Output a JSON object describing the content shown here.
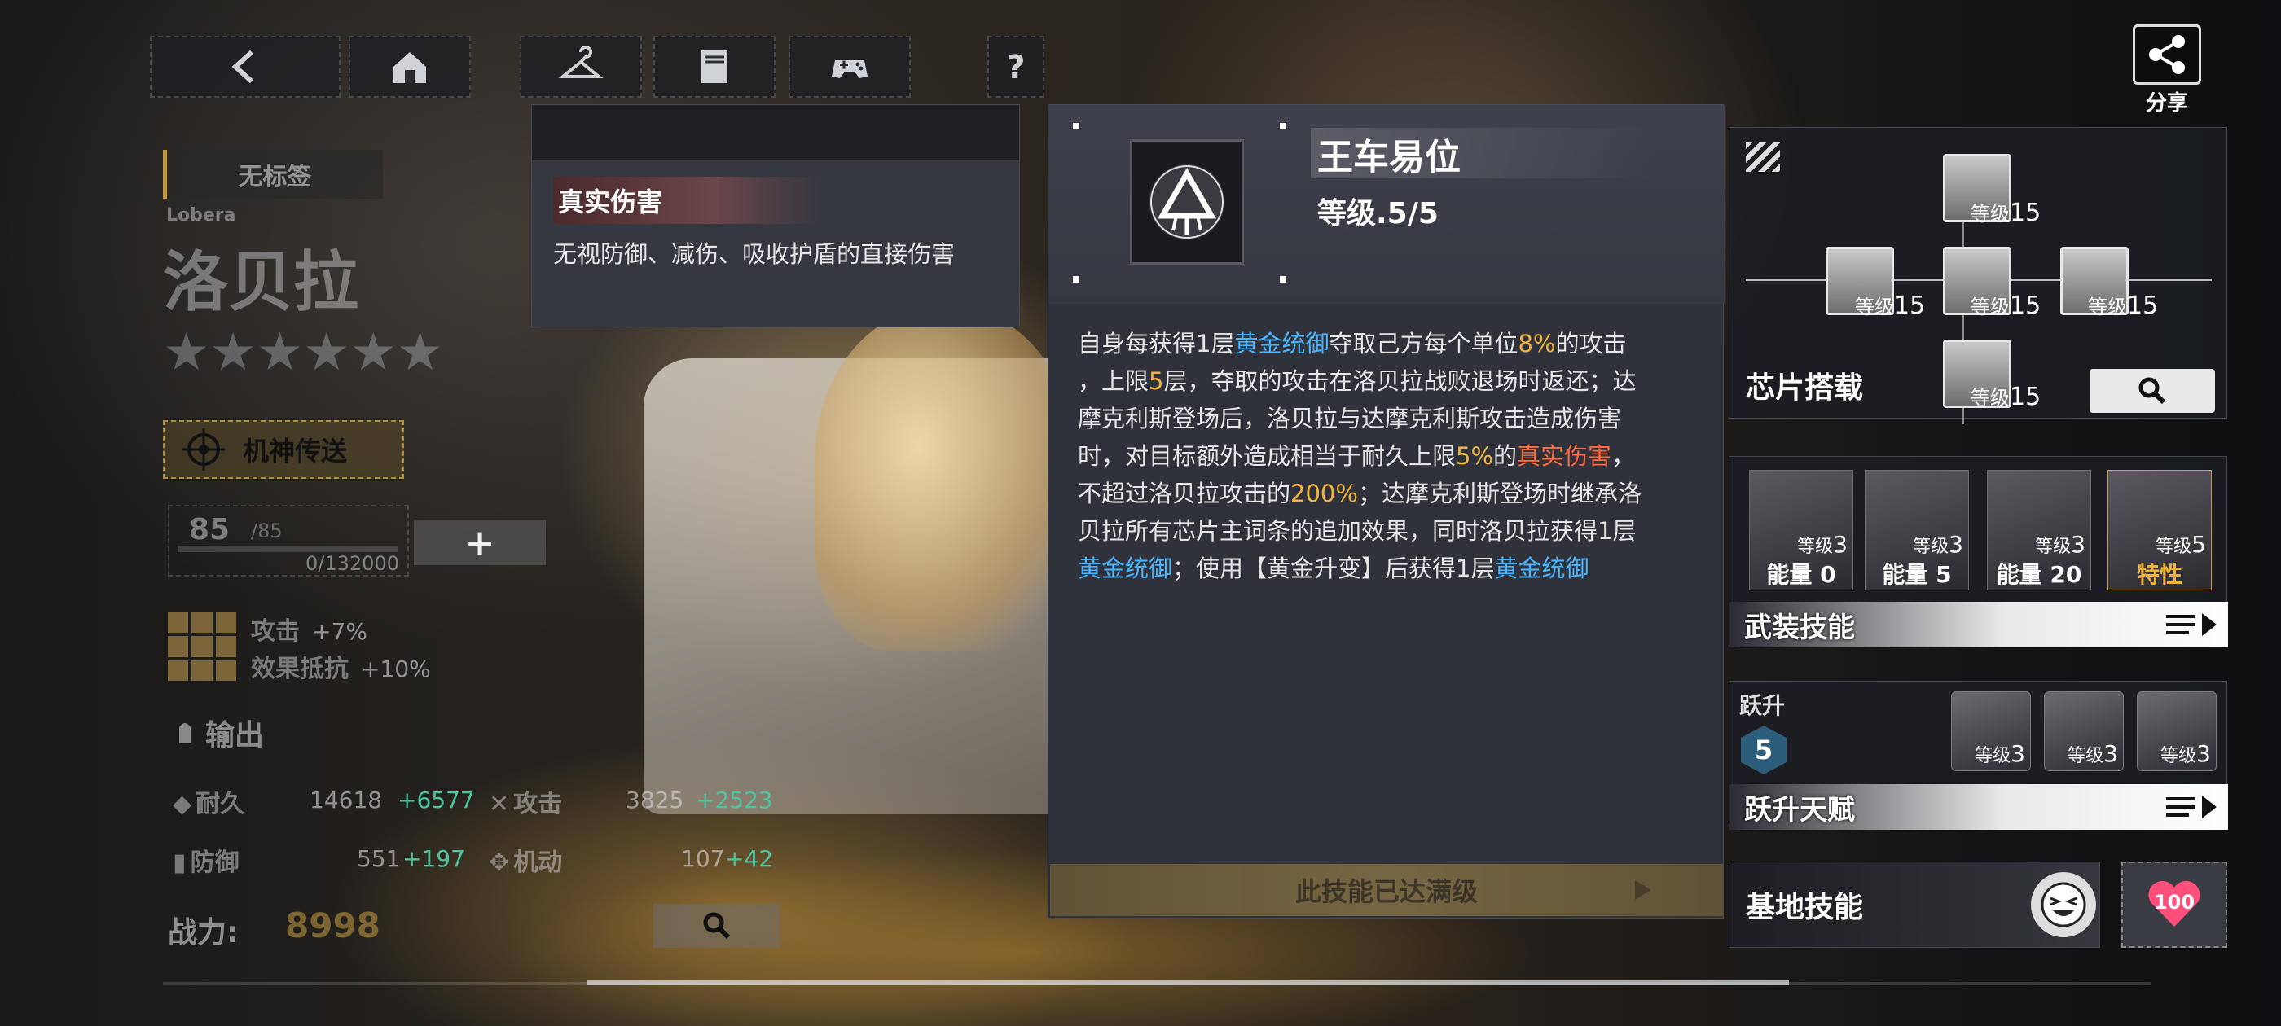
{
  "nav": {
    "back_label": "<",
    "share_label": "分享"
  },
  "left": {
    "tag": "无标签",
    "name_en": "Lobera",
    "name_cn": "洛贝拉",
    "stars": "★★★★★★",
    "badge": "机神传送",
    "level": "85",
    "level_max": "/85",
    "exp": "0/132000",
    "add_label": "+",
    "bonus1_label": "攻击",
    "bonus1_value": "+7%",
    "bonus2_label": "效果抵抗",
    "bonus2_value": "+10%",
    "role": "输出",
    "stats": {
      "hp_label": "耐久",
      "hp_value": "14618",
      "hp_bonus": "+6577",
      "atk_label": "攻击",
      "atk_value": "3825",
      "atk_bonus": "+2523",
      "def_label": "防御",
      "def_value": "551",
      "def_bonus": "+197",
      "mob_label": "机动",
      "mob_value": "107",
      "mob_bonus": "+42"
    },
    "power_label": "战力:",
    "power_value": "8998"
  },
  "tooltip": {
    "title": "真实伤害",
    "desc": "无视防御、减伤、吸收护盾的直接伤害"
  },
  "detail": {
    "title": "王车易位",
    "level": "等级.5/5",
    "p1": "自身每获得1层",
    "p1_kw1": "黄金统御",
    "p2": "夺取己方每个单位",
    "p2_n1": "8%",
    "p3": "的攻击",
    "p4": "，上限",
    "p4_n": "5",
    "p5": "层，夺取的攻击在洛贝拉战败退场时返还；达",
    "p6": "摩克利斯登场后，洛贝拉与达摩克利斯攻击造成伤害",
    "p7": "时，对目标额外造成相当于耐久上限",
    "p7_n": "5%",
    "p7_b": "的",
    "p7_kw": "真实伤害",
    "p7_c": "，",
    "p8": "不超过洛贝拉攻击的",
    "p8_n": "200%",
    "p8_b": "；达摩克利斯登场时继承洛",
    "p9": "贝拉所有芯片主词条的追加效果，同时洛贝拉获得1层",
    "p10_kw": "黄金统御",
    "p10": "；使用【黄金升变】后获得1层",
    "p10_kw2": "黄金统御",
    "max_label": "此技能已达满级"
  },
  "chips": {
    "section": "芯片搭载",
    "lv_prefix": "等级",
    "lv_top": "15",
    "lv_left": "15",
    "lv_center": "15",
    "lv_right": "15",
    "lv_bottom": "15"
  },
  "skills": {
    "section": "武装技能",
    "items": [
      {
        "lv_prefix": "等级",
        "lv": "3",
        "energy_label": "能量",
        "energy": "0"
      },
      {
        "lv_prefix": "等级",
        "lv": "3",
        "energy_label": "能量",
        "energy": "5"
      },
      {
        "lv_prefix": "等级",
        "lv": "3",
        "energy_label": "能量",
        "energy": "20"
      },
      {
        "lv_prefix": "等级",
        "lv": "5",
        "trait": "特性"
      }
    ]
  },
  "ascend": {
    "label": "跃升",
    "rank": "5",
    "section": "跃升天赋",
    "items": [
      {
        "lv_prefix": "等级",
        "lv": "3"
      },
      {
        "lv_prefix": "等级",
        "lv": "3"
      },
      {
        "lv_prefix": "等级",
        "lv": "3"
      }
    ]
  },
  "base": {
    "section": "基地技能",
    "heart_value": "100"
  },
  "colors": {
    "gold": "#f0b43c",
    "keyword_blue": "#4ab6ff",
    "keyword_red": "#ff6a3a",
    "bonus_green": "#4bc6a0"
  }
}
